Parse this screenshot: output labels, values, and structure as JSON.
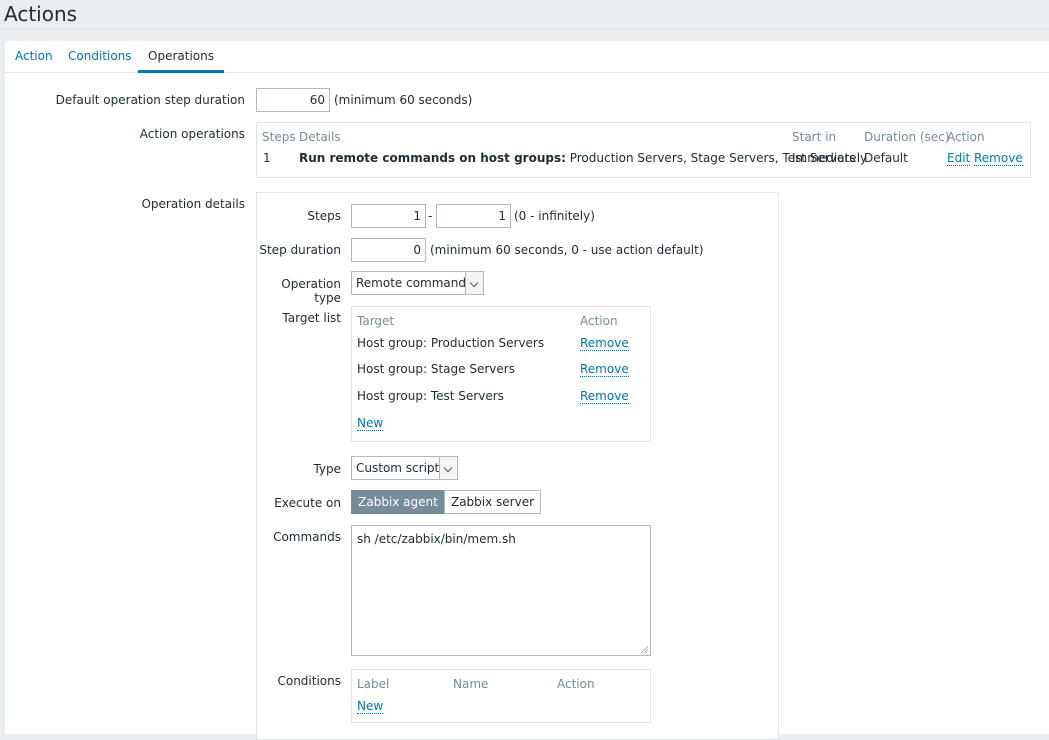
{
  "header": {
    "title": "Actions"
  },
  "tabs": [
    {
      "label": "Action"
    },
    {
      "label": "Conditions"
    },
    {
      "label": "Operations"
    }
  ],
  "form": {
    "default_step_label": "Default operation step duration",
    "default_step_value": "60",
    "default_step_hint": "(minimum 60 seconds)",
    "action_operations_label": "Action operations",
    "action_operations": {
      "headers": {
        "steps": "Steps",
        "details": "Details",
        "start_in": "Start in",
        "duration": "Duration (sec)",
        "action": "Action"
      },
      "rows": [
        {
          "steps": "1",
          "details_bold": "Run remote commands on host groups:",
          "details_rest": " Production Servers, Stage Servers, Test Servers",
          "start_in": "Immediately",
          "duration": "Default",
          "edit": "Edit",
          "remove": "Remove"
        }
      ]
    },
    "operation_details_label": "Operation details",
    "details": {
      "steps_label": "Steps",
      "steps_from": "1",
      "steps_sep": "-",
      "steps_to": "1",
      "steps_hint": "(0 - infinitely)",
      "step_duration_label": "Step duration",
      "step_duration_value": "0",
      "step_duration_hint": "(minimum 60 seconds, 0 - use action default)",
      "operation_type_label": "Operation type",
      "operation_type_value": "Remote command",
      "target_list_label": "Target list",
      "target_headers": {
        "target": "Target",
        "action": "Action"
      },
      "targets": [
        {
          "name": "Host group: Production Servers",
          "remove": "Remove"
        },
        {
          "name": "Host group: Stage Servers",
          "remove": "Remove"
        },
        {
          "name": "Host group: Test Servers",
          "remove": "Remove"
        }
      ],
      "target_new": "New",
      "type_label": "Type",
      "type_value": "Custom script",
      "execute_on_label": "Execute on",
      "execute_options": [
        "Zabbix agent",
        "Zabbix server"
      ],
      "commands_label": "Commands",
      "commands_value": "sh /etc/zabbix/bin/mem.sh",
      "conditions_label": "Conditions",
      "conditions_headers": {
        "label": "Label",
        "name": "Name",
        "action": "Action"
      },
      "conditions_new": "New"
    }
  },
  "colors": {
    "link": "#0275b8",
    "selected_button": "#768d99",
    "header_text": "#768d99"
  }
}
